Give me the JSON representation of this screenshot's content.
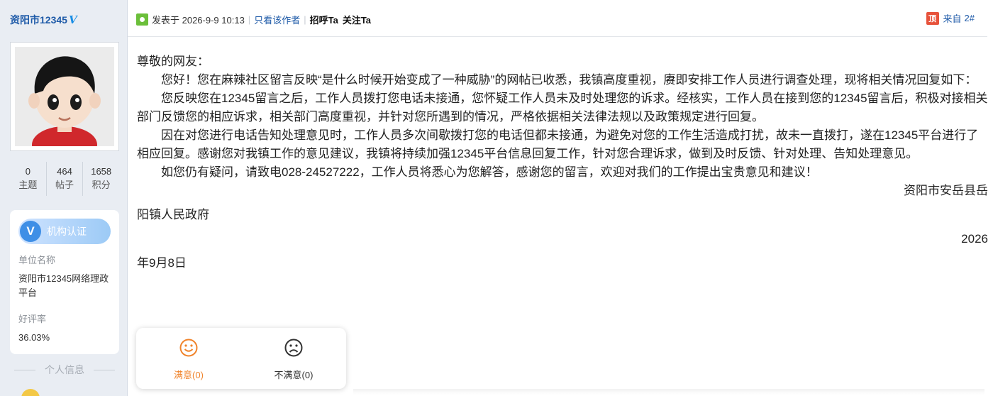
{
  "author": {
    "name": "资阳市12345",
    "verified_icon": "v-verified-icon"
  },
  "stats": [
    {
      "num": "0",
      "label": "主题"
    },
    {
      "num": "464",
      "label": "帖子"
    },
    {
      "num": "1658",
      "label": "积分"
    }
  ],
  "cert": {
    "button_label": "机构认证",
    "unit_name_label": "单位名称",
    "unit_name_value": "资阳市12345网络理政平台",
    "rating_label": "好评率",
    "rating_value": "36.03%"
  },
  "sidebar_section": "个人信息",
  "post_header": {
    "posted_at": "发表于 2026-9-9 10:13",
    "only_author": "只看该作者",
    "greet": "招呼Ta",
    "follow": "关注Ta",
    "from_label": "来自",
    "floor": "2#",
    "top_icon_text": "顶"
  },
  "post_body": {
    "salutation": "尊敬的网友：",
    "p1": "您好！您在麻辣社区留言反映“是什么时候开始变成了一种威胁”的网帖已收悉，我镇高度重视，赓即安排工作人员进行调查处理，现将相关情况回复如下：",
    "p2": "您反映您在12345留言之后，工作人员拨打您电话未接通，您怀疑工作人员未及时处理您的诉求。经核实，工作人员在接到您的12345留言后，积极对接相关部门反馈您的相应诉求，相关部门高度重视，并针对您所遇到的情况，严格依据相关法律法规以及政策规定进行回复。",
    "p3": "因在对您进行电话告知处理意见时，工作人员多次间歇拨打您的电话但都未接通，为避免对您的工作生活造成打扰，故未一直拨打，遂在12345平台进行了相应回复。感谢您对我镇工作的意见建议，我镇将持续加强12345平台信息回复工作，针对您合理诉求，做到及时反馈、针对处理、告知处理意见。",
    "p4": "如您仍有疑问，请致电028-24527222，工作人员将悉心为您解答，感谢您的留言，欢迎对我们的工作提出宝贵意见和建议！",
    "sign1": "资阳市安岳县岳",
    "sign2": "阳镇人民政府",
    "date1": "2026",
    "date2": "年9月8日"
  },
  "rating": {
    "satisfied": "满意(0)",
    "unsatisfied": "不满意(0)",
    "satisfied_color": "#f0842c"
  }
}
